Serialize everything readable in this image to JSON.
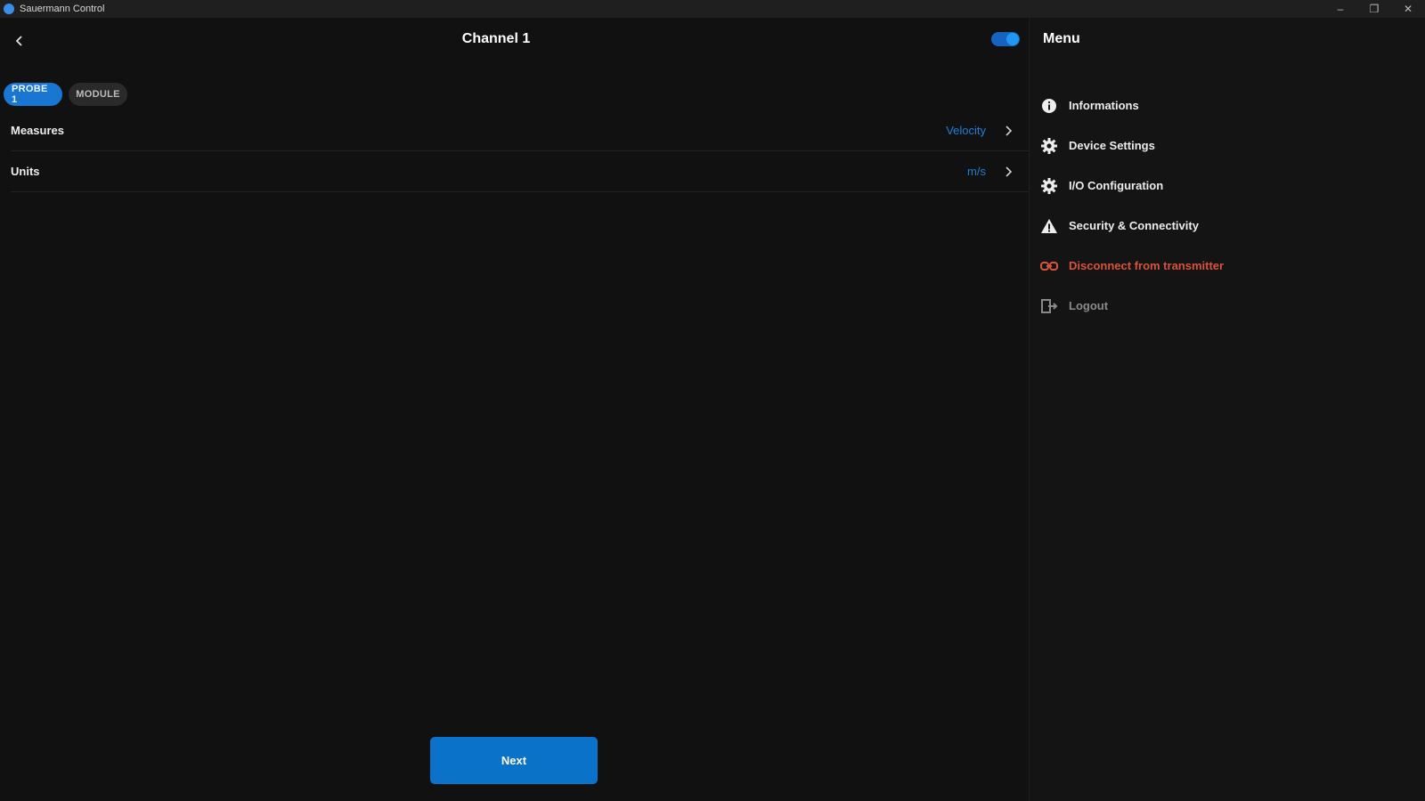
{
  "window": {
    "title": "Sauermann Control",
    "controls": {
      "minimize": "–",
      "maximize": "❐",
      "close": "✕"
    }
  },
  "header": {
    "title": "Channel 1",
    "toggle_on": true,
    "accent_color": "#1976d2"
  },
  "tabs": [
    {
      "label": "PROBE 1",
      "active": true
    },
    {
      "label": "MODULE",
      "active": false
    }
  ],
  "settings": [
    {
      "label": "Measures",
      "value": "Velocity"
    },
    {
      "label": "Units",
      "value": "m/s"
    }
  ],
  "footer": {
    "next_label": "Next"
  },
  "menu": {
    "title": "Menu",
    "items": [
      {
        "label": "Informations",
        "icon": "info-icon",
        "style": "normal"
      },
      {
        "label": "Device Settings",
        "icon": "gear-icon",
        "style": "normal"
      },
      {
        "label": "I/O Configuration",
        "icon": "gear-icon",
        "style": "normal"
      },
      {
        "label": "Security & Connectivity",
        "icon": "warning-icon",
        "style": "normal"
      },
      {
        "label": "Disconnect from transmitter",
        "icon": "unlink-icon",
        "style": "danger"
      },
      {
        "label": "Logout",
        "icon": "logout-icon",
        "style": "muted"
      }
    ]
  }
}
